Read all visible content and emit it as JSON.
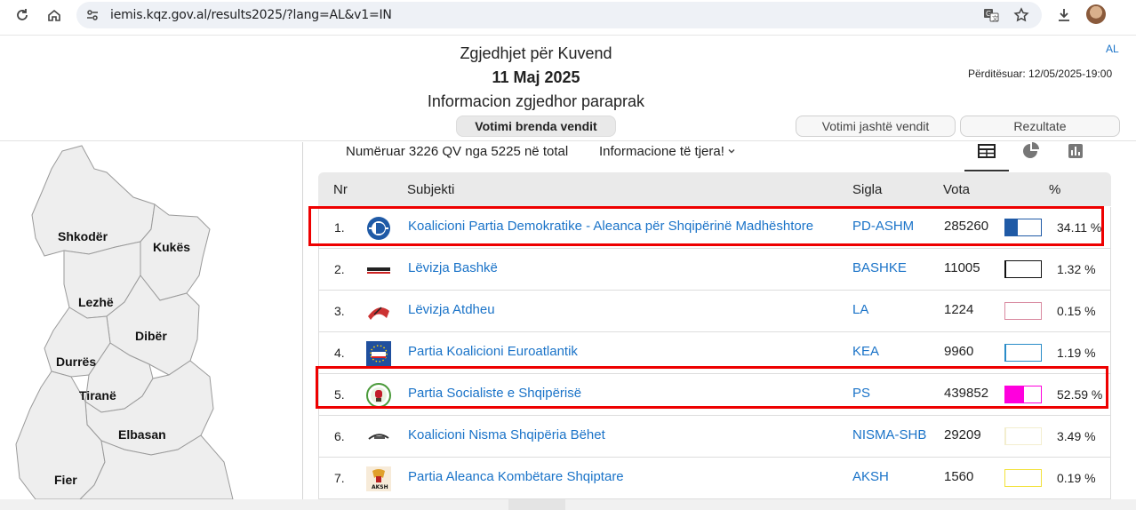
{
  "browser": {
    "url": "iemis.kqz.gov.al/results2025/?lang=AL&v1=IN"
  },
  "header": {
    "title": "Zgjedhjet për Kuvend",
    "date": "11 Maj 2025",
    "subtitle": "Informacion zgjedhor paraprak",
    "lang": "AL",
    "updated": "Përditësuar: 12/05/2025-19:00"
  },
  "tabs": {
    "inside": "Votimi brenda vendit",
    "abroad": "Votimi jashtë vendit",
    "results": "Rezultate"
  },
  "map": {
    "regions": [
      "Shkodër",
      "Kukës",
      "Lezhë",
      "Dibër",
      "Durrës",
      "Tiranë",
      "Elbasan",
      "Fier"
    ]
  },
  "info": {
    "counted": "Numëruar 3226 QV nga 5225 në total",
    "other": "Informacione të tjera!"
  },
  "table": {
    "headers": {
      "nr": "Nr",
      "subject": "Subjekti",
      "acronym": "Sigla",
      "votes": "Vota",
      "pct": "%"
    },
    "rows": [
      {
        "nr": "1.",
        "name": "Koalicioni Partia Demokratike - Aleanca për Shqipërinë Madhështore",
        "acronym": "PD-ASHM",
        "votes": "285260",
        "pct": "34.11 %",
        "share": 34.11,
        "color": "#1f5aa6",
        "logo": "pd-logo-icon",
        "highlight": true
      },
      {
        "nr": "2.",
        "name": "Lëvizja Bashkë",
        "acronym": "BASHKE",
        "votes": "11005",
        "pct": "1.32 %",
        "share": 1.32,
        "color": "#111111",
        "logo": "bashke-logo-icon",
        "highlight": false
      },
      {
        "nr": "3.",
        "name": "Lëvizja Atdheu",
        "acronym": "LA",
        "votes": "1224",
        "pct": "0.15 %",
        "share": 0.15,
        "color": "#d98aa0",
        "logo": "la-logo-icon",
        "highlight": false
      },
      {
        "nr": "4.",
        "name": "Partia Koalicioni Euroatlantik",
        "acronym": "KEA",
        "votes": "9960",
        "pct": "1.19 %",
        "share": 1.19,
        "color": "#2a8cc8",
        "logo": "kea-logo-icon",
        "highlight": false
      },
      {
        "nr": "5.",
        "name": "Partia Socialiste e Shqipërisë",
        "acronym": "PS",
        "votes": "439852",
        "pct": "52.59 %",
        "share": 52.59,
        "color": "#ff00dd",
        "logo": "ps-logo-icon",
        "highlight": true
      },
      {
        "nr": "6.",
        "name": "Koalicioni Nisma Shqipëria Bëhet",
        "acronym": "NISMA-SHB",
        "votes": "29209",
        "pct": "3.49 %",
        "share": 3.49,
        "color": "#f3eecf",
        "logo": "nisma-logo-icon",
        "highlight": false
      },
      {
        "nr": "7.",
        "name": "Partia Aleanca Kombëtare Shqiptare",
        "acronym": "AKSH",
        "votes": "1560",
        "pct": "0.19 %",
        "share": 0.19,
        "color": "#f2e23a",
        "logo": "aksh-logo-icon",
        "highlight": false
      }
    ]
  }
}
